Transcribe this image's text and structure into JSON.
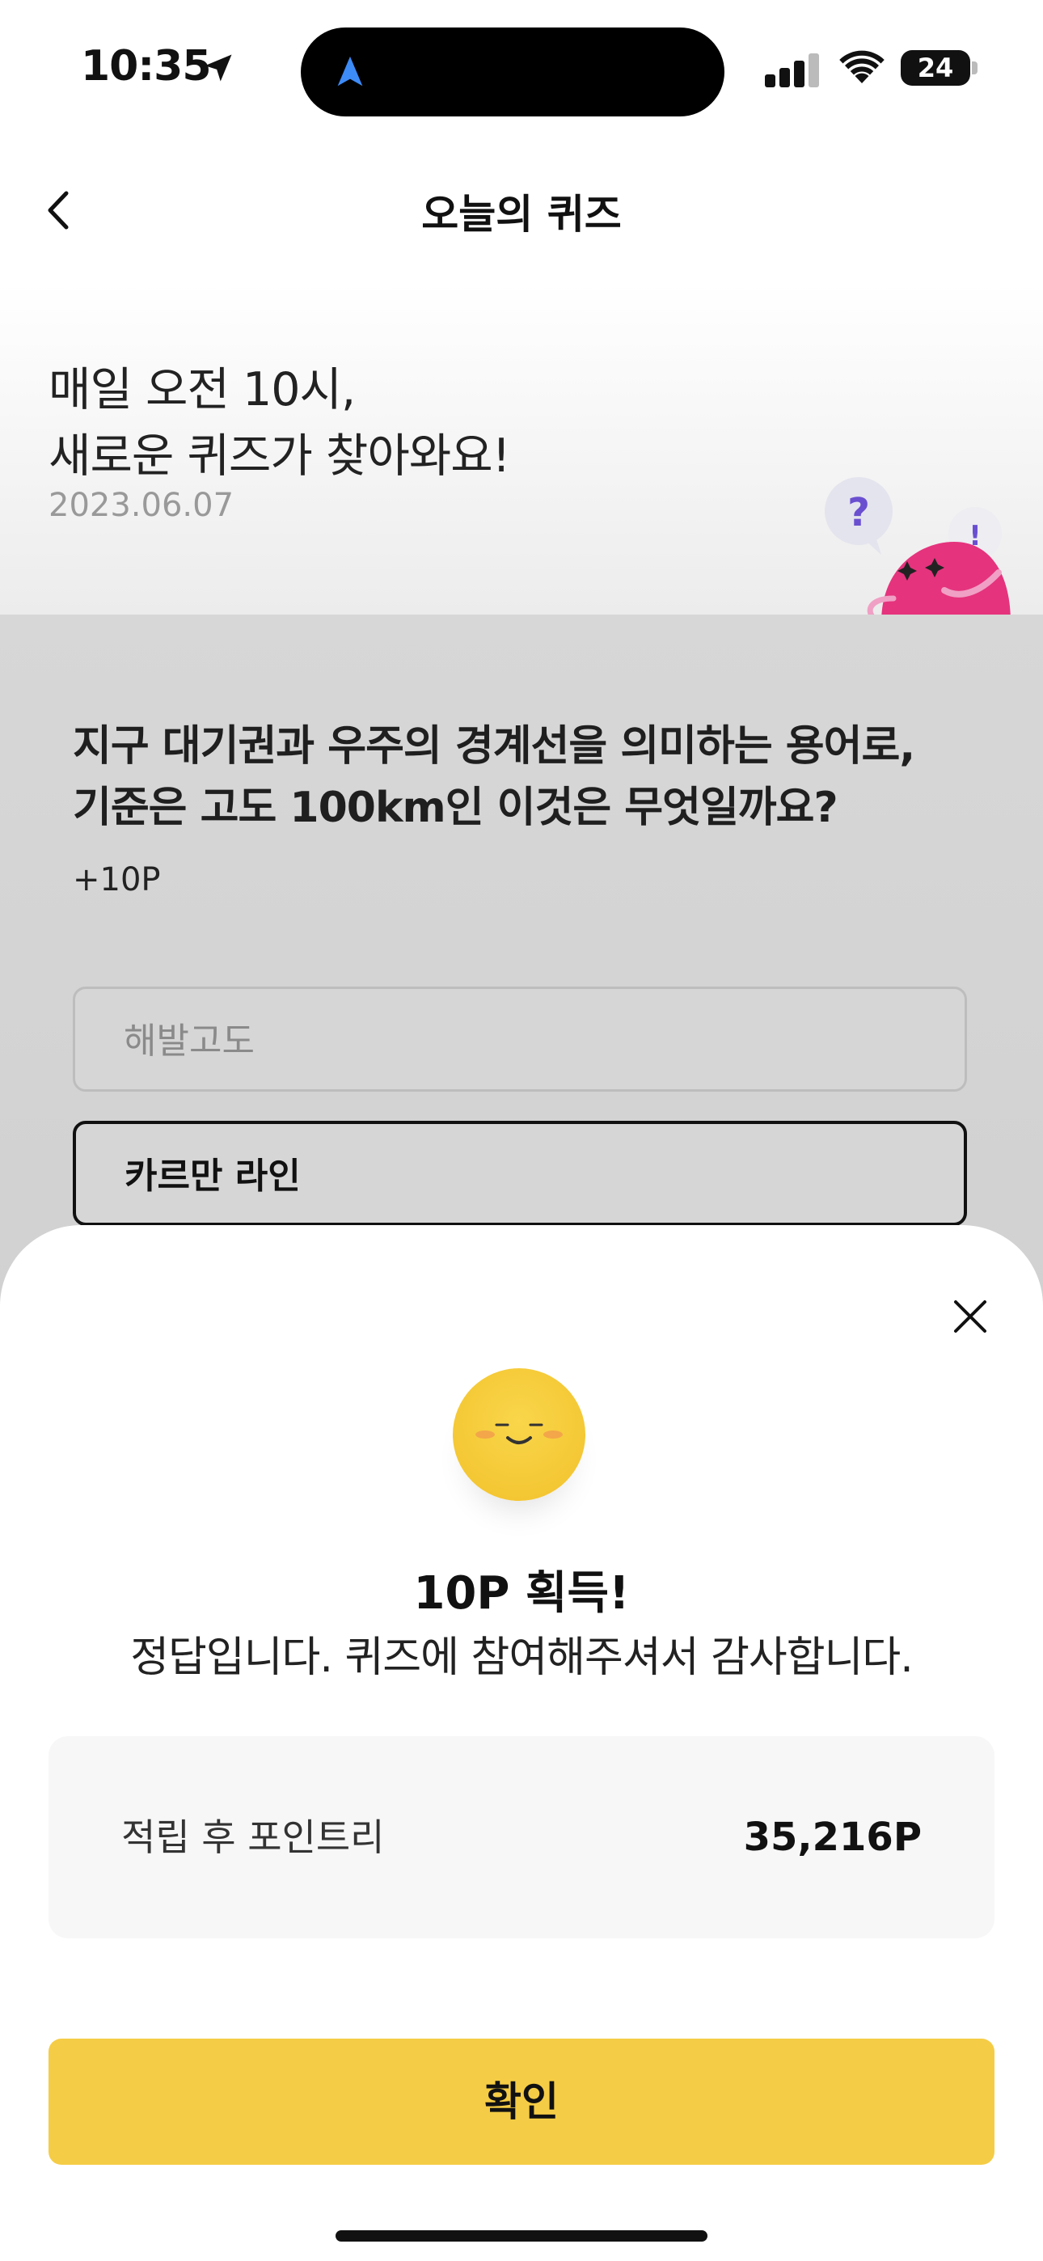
{
  "status_bar": {
    "time": "10:35",
    "battery": "24",
    "icons": [
      "location-arrow-icon",
      "navigation-icon",
      "cellular-signal-icon",
      "wifi-icon",
      "battery-icon"
    ]
  },
  "header": {
    "title": "오늘의 퀴즈",
    "back_icon": "chevron-left-icon"
  },
  "hero": {
    "line1": "매일 오전 10시,",
    "line2": "새로운 퀴즈가 찾아와요!",
    "date": "2023.06.07",
    "mascot_marks": {
      "question": "?",
      "exclaim": "!"
    }
  },
  "quiz": {
    "question_line1": "지구 대기권과 우주의 경계선을 의미하는 용어로,",
    "question_line2": "기준은 고도 100km인 이것은 무엇일까요?",
    "reward": "+10P",
    "options": [
      {
        "label": "해발고도",
        "selected": false
      },
      {
        "label": "카르만 라인",
        "selected": true
      }
    ]
  },
  "result_sheet": {
    "close_icon": "close-icon",
    "title": "10P 획득!",
    "message": "정답입니다. 퀴즈에 참여해주셔서 감사합니다.",
    "points_label": "적립 후 포인트리",
    "points_value": "35,216P",
    "confirm_label": "확인"
  },
  "colors": {
    "accent": "#F5CC45",
    "mascot_pink": "#E5337D",
    "mascot_bubble_purple": "#6A4FD0",
    "nav_blue": "#3D8BF7"
  }
}
